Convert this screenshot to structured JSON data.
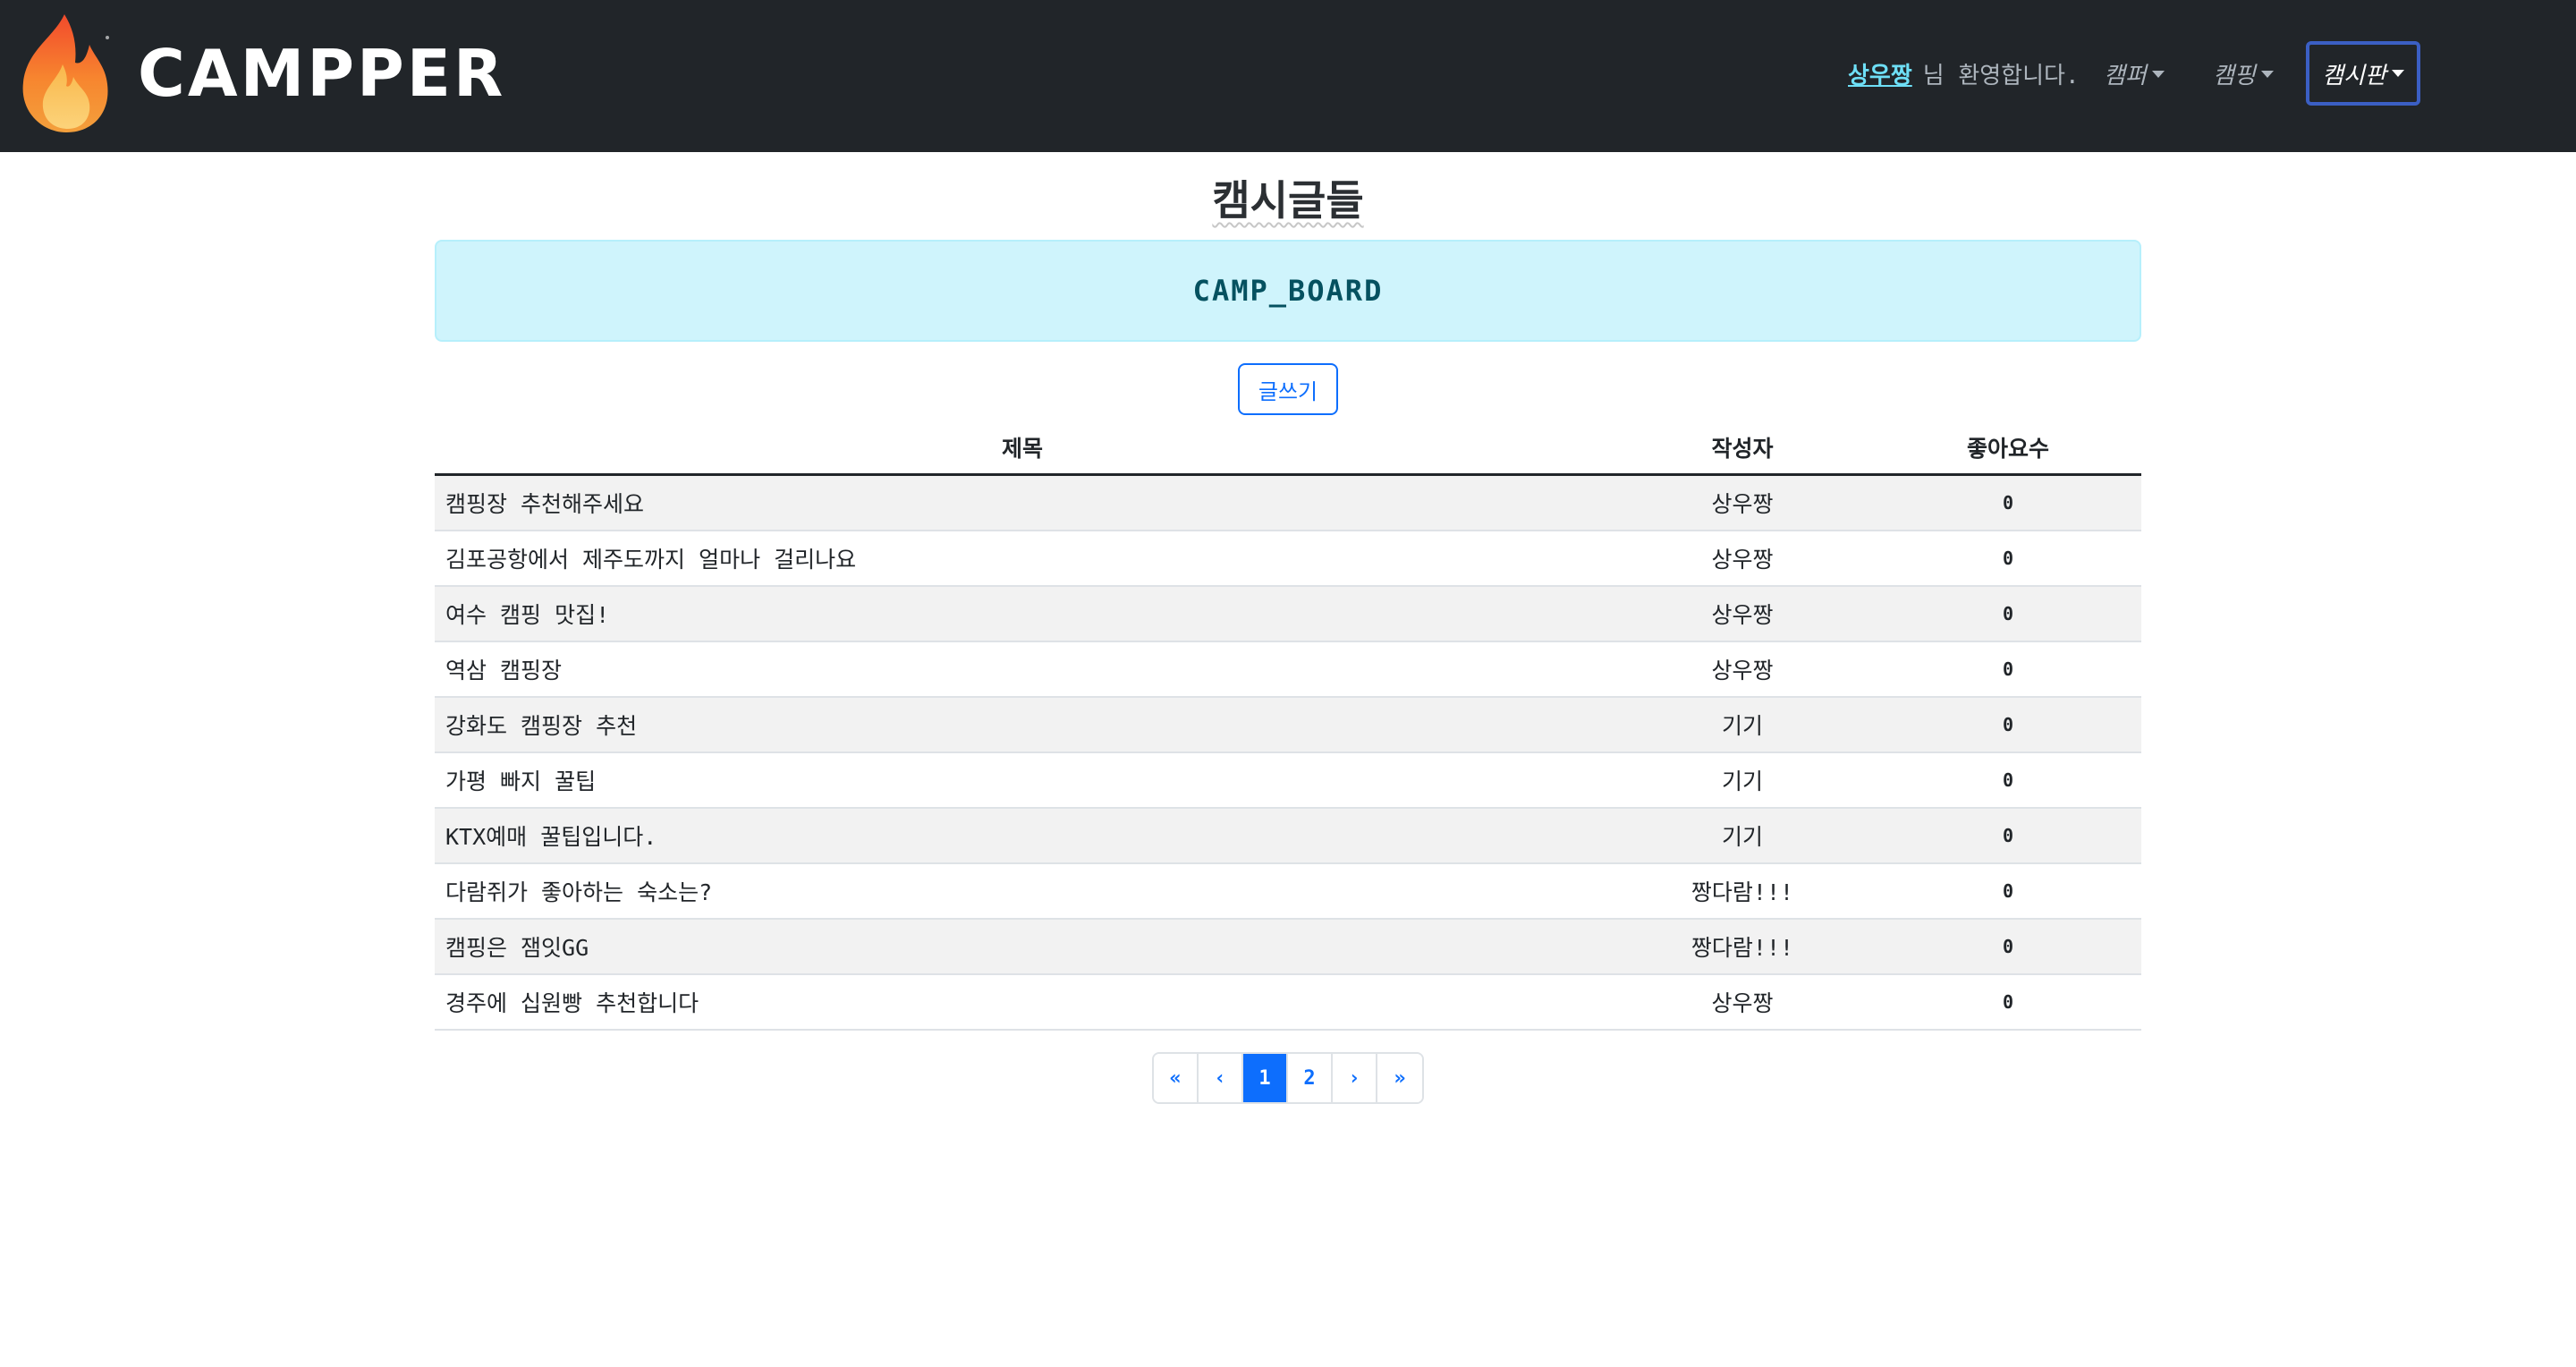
{
  "navbar": {
    "brand": "CAMPPER",
    "username": "상우짱",
    "welcome_suffix": "님 환영합니다.",
    "menu": [
      "캠퍼",
      "캠핑"
    ],
    "active_menu": "캠시판"
  },
  "page": {
    "title": "캠시글들",
    "banner": "CAMP_BOARD",
    "write_button": "글쓰기"
  },
  "table": {
    "headers": {
      "title": "제목",
      "writer": "작성자",
      "likes": "좋아요수"
    },
    "rows": [
      {
        "title": "캠핑장 추천해주세요",
        "writer": "상우짱",
        "likes": "0"
      },
      {
        "title": "김포공항에서 제주도까지 얼마나 걸리나요",
        "writer": "상우짱",
        "likes": "0"
      },
      {
        "title": "여수 캠핑 맛집!",
        "writer": "상우짱",
        "likes": "0"
      },
      {
        "title": "역삼 캠핑장",
        "writer": "상우짱",
        "likes": "0"
      },
      {
        "title": "강화도 캠핑장 추천",
        "writer": "기기",
        "likes": "0"
      },
      {
        "title": "가평 빠지 꿀팁",
        "writer": "기기",
        "likes": "0"
      },
      {
        "title": "KTX예매 꿀팁입니다.",
        "writer": "기기",
        "likes": "0"
      },
      {
        "title": "다람쥐가 좋아하는 숙소는?",
        "writer": "짱다람!!!",
        "likes": "0"
      },
      {
        "title": "캠핑은 잼잇GG",
        "writer": "짱다람!!!",
        "likes": "0"
      },
      {
        "title": "경주에 십원빵 추천합니다",
        "writer": "상우짱",
        "likes": "0"
      }
    ]
  },
  "pagination": {
    "first": "«",
    "prev": "‹",
    "pages": [
      "1",
      "2"
    ],
    "current": "1",
    "next": "›",
    "last": "»"
  },
  "colors": {
    "navbar_bg": "#212529",
    "accent": "#0d6efd",
    "banner_bg": "#cff4fc",
    "username": "#6edff6"
  },
  "icons": {
    "logo": "flame-logo-icon"
  }
}
